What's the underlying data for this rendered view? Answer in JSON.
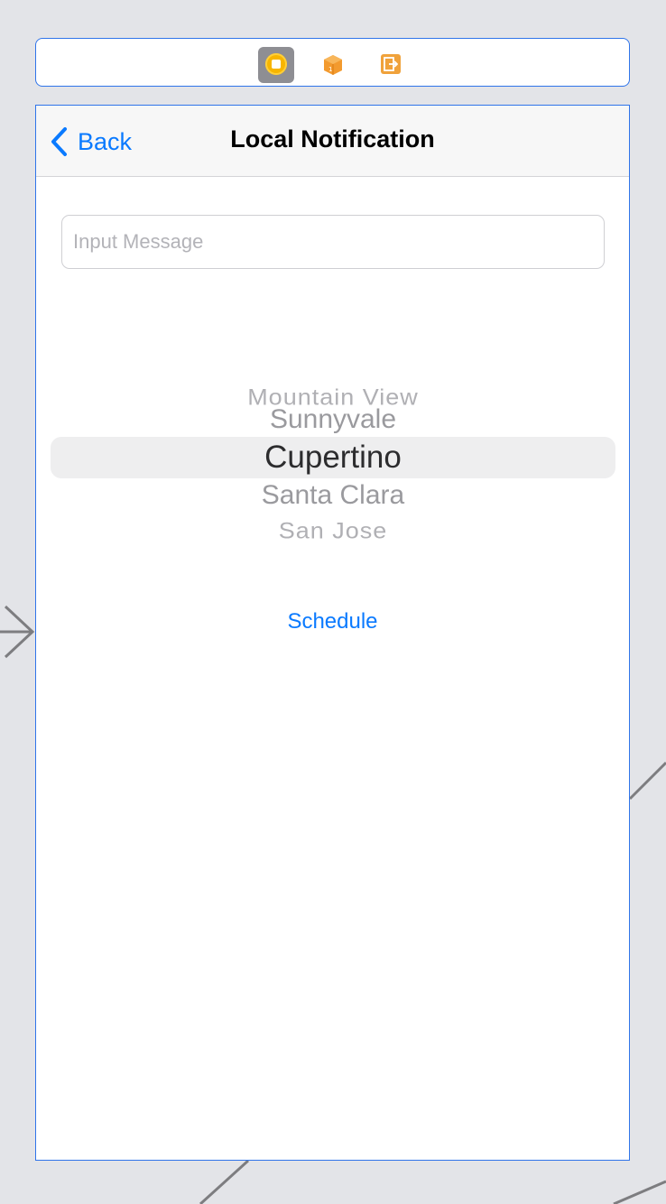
{
  "scene_dock": {
    "icons": [
      "view-controller-icon",
      "first-responder-icon",
      "exit-icon"
    ],
    "accent": "#2f74ea"
  },
  "navigation": {
    "back_label": "Back",
    "title": "Local Notification",
    "tint": "#0a7aff"
  },
  "message_field": {
    "placeholder": "Input Message",
    "value": ""
  },
  "picker": {
    "options": [
      "Mountain View",
      "Sunnyvale",
      "Cupertino",
      "Santa Clara",
      "San Jose"
    ],
    "selected": "Cupertino"
  },
  "actions": {
    "schedule_label": "Schedule"
  }
}
